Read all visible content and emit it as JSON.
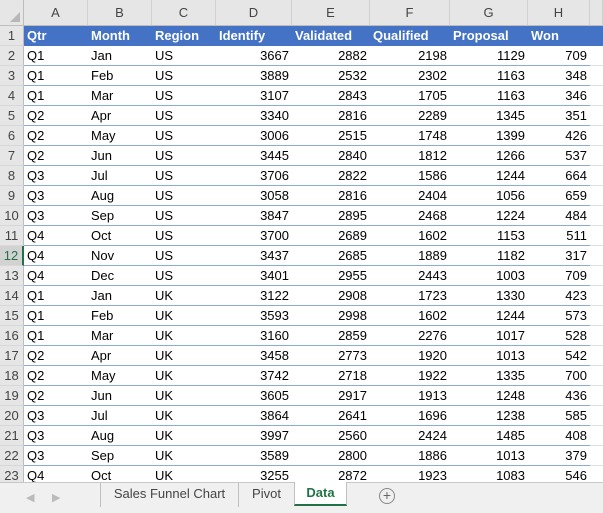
{
  "columns": [
    "A",
    "B",
    "C",
    "D",
    "E",
    "F",
    "G",
    "H"
  ],
  "header": [
    "Qtr",
    "Month",
    "Region",
    "Identify",
    "Validated",
    "Qualified",
    "Proposal",
    "Won"
  ],
  "rows": [
    [
      "Q1",
      "Jan",
      "US",
      3667,
      2882,
      2198,
      1129,
      709
    ],
    [
      "Q1",
      "Feb",
      "US",
      3889,
      2532,
      2302,
      1163,
      348
    ],
    [
      "Q1",
      "Mar",
      "US",
      3107,
      2843,
      1705,
      1163,
      346
    ],
    [
      "Q2",
      "Apr",
      "US",
      3340,
      2816,
      2289,
      1345,
      351
    ],
    [
      "Q2",
      "May",
      "US",
      3006,
      2515,
      1748,
      1399,
      426
    ],
    [
      "Q2",
      "Jun",
      "US",
      3445,
      2840,
      1812,
      1266,
      537
    ],
    [
      "Q3",
      "Jul",
      "US",
      3706,
      2822,
      1586,
      1244,
      664
    ],
    [
      "Q3",
      "Aug",
      "US",
      3058,
      2816,
      2404,
      1056,
      659
    ],
    [
      "Q3",
      "Sep",
      "US",
      3847,
      2895,
      2468,
      1224,
      484
    ],
    [
      "Q4",
      "Oct",
      "US",
      3700,
      2689,
      1602,
      1153,
      511
    ],
    [
      "Q4",
      "Nov",
      "US",
      3437,
      2685,
      1889,
      1182,
      317
    ],
    [
      "Q4",
      "Dec",
      "US",
      3401,
      2955,
      2443,
      1003,
      709
    ],
    [
      "Q1",
      "Jan",
      "UK",
      3122,
      2908,
      1723,
      1330,
      423
    ],
    [
      "Q1",
      "Feb",
      "UK",
      3593,
      2998,
      1602,
      1244,
      573
    ],
    [
      "Q1",
      "Mar",
      "UK",
      3160,
      2859,
      2276,
      1017,
      528
    ],
    [
      "Q2",
      "Apr",
      "UK",
      3458,
      2773,
      1920,
      1013,
      542
    ],
    [
      "Q2",
      "May",
      "UK",
      3742,
      2718,
      1922,
      1335,
      700
    ],
    [
      "Q2",
      "Jun",
      "UK",
      3605,
      2917,
      1913,
      1248,
      436
    ],
    [
      "Q3",
      "Jul",
      "UK",
      3864,
      2641,
      1696,
      1238,
      585
    ],
    [
      "Q3",
      "Aug",
      "UK",
      3997,
      2560,
      2424,
      1485,
      408
    ],
    [
      "Q3",
      "Sep",
      "UK",
      3589,
      2800,
      1886,
      1013,
      379
    ],
    [
      "Q4",
      "Oct",
      "UK",
      3255,
      2872,
      1923,
      1083,
      546
    ]
  ],
  "selected_row": 12,
  "tabs": [
    {
      "label": "Sales Funnel Chart"
    },
    {
      "label": "Pivot"
    },
    {
      "label": "Data",
      "active": true
    }
  ],
  "colors": {
    "header_fill": "#4472c4",
    "accent": "#217346"
  }
}
